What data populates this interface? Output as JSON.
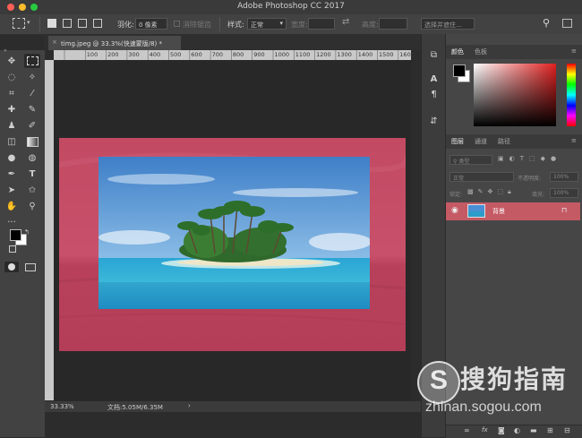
{
  "window": {
    "title": "Adobe Photoshop CC 2017",
    "traffic_colors": [
      "#fe5f57",
      "#febc2e",
      "#28c840"
    ]
  },
  "options_bar": {
    "feather_label": "羽化:",
    "feather_value": "0 像素",
    "antialias_label": "消除锯齿",
    "style_label": "样式:",
    "style_value": "正常",
    "width_label": "宽度:",
    "height_label": "高度:",
    "select_mask_button": "选择并遮住..."
  },
  "document": {
    "tab_title": "timg.jpeg @ 33.3%(快速蒙版/8) *",
    "ruler_ticks": [
      "100",
      "200",
      "300",
      "400",
      "500",
      "600",
      "700",
      "800",
      "900",
      "1000",
      "1100",
      "1200",
      "1300",
      "1400",
      "1500",
      "1600"
    ],
    "zoom": "33.33%",
    "doc_size": "文档:5.05M/6.35M",
    "mask_color": "#c24860"
  },
  "color_panel": {
    "tabs": [
      "颜色",
      "色板"
    ],
    "foreground": "#000000",
    "background": "#ffffff",
    "field_hue": "#e02020"
  },
  "layers_panel": {
    "tabs": [
      "图层",
      "通道",
      "路径"
    ],
    "filter_placeholder": "类型",
    "blend_mode": "正常",
    "opacity_label": "不透明度:",
    "opacity_value": "100%",
    "lock_label": "锁定:",
    "fill_label": "填充:",
    "fill_value": "100%",
    "layers": [
      {
        "name": "背景",
        "selected": true
      }
    ],
    "footer_icons": [
      "link-icon",
      "fx-icon",
      "mask-icon",
      "adjustment-icon",
      "folder-icon",
      "new-layer-icon",
      "trash-icon"
    ]
  },
  "watermark": {
    "brand": "搜狗指南",
    "url": "zhinan.sogou.com"
  }
}
